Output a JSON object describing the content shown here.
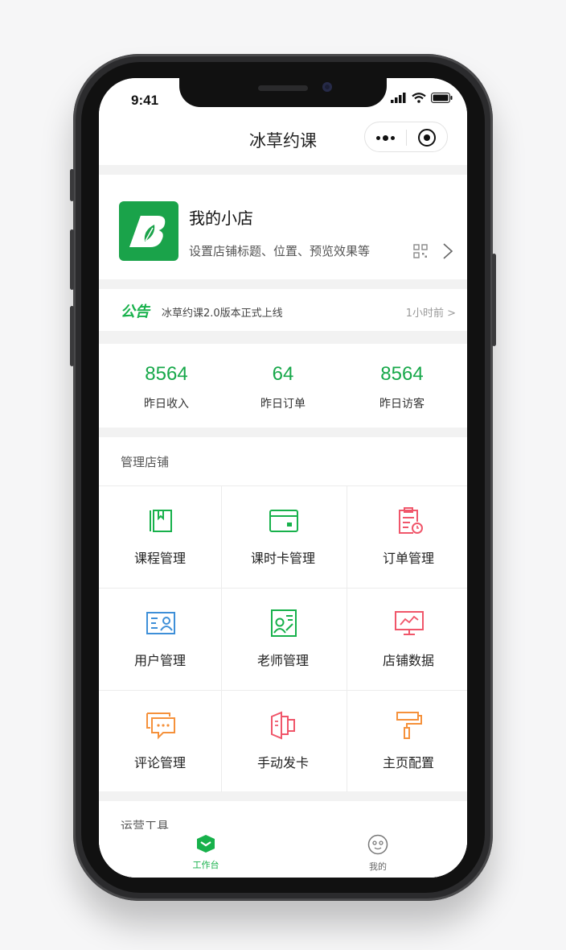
{
  "status_bar": {
    "time": "9:41"
  },
  "nav": {
    "title": "冰草约课"
  },
  "shop": {
    "name": "我的小店",
    "desc": "设置店铺标题、位置、预览效果等"
  },
  "notice": {
    "tag": "公告",
    "text": "冰草约课2.0版本正式上线",
    "time": "1小时前 >"
  },
  "stats": [
    {
      "value": "8564",
      "label": "昨日收入"
    },
    {
      "value": "64",
      "label": "昨日订单"
    },
    {
      "value": "8564",
      "label": "昨日访客"
    }
  ],
  "manage": {
    "title": "管理店铺",
    "items": [
      {
        "label": "课程管理",
        "icon": "course-icon",
        "color": "#17b14b"
      },
      {
        "label": "课时卡管理",
        "icon": "card-icon",
        "color": "#17b14b"
      },
      {
        "label": "订单管理",
        "icon": "order-icon",
        "color": "#f0566a"
      },
      {
        "label": "用户管理",
        "icon": "user-card-icon",
        "color": "#3e8fd8"
      },
      {
        "label": "老师管理",
        "icon": "teacher-icon",
        "color": "#17b14b"
      },
      {
        "label": "店铺数据",
        "icon": "data-screen-icon",
        "color": "#f0566a"
      },
      {
        "label": "评论管理",
        "icon": "comment-icon",
        "color": "#f5913b"
      },
      {
        "label": "手动发卡",
        "icon": "issue-card-icon",
        "color": "#f0566a"
      },
      {
        "label": "主页配置",
        "icon": "paint-roller-icon",
        "color": "#f5913b"
      }
    ]
  },
  "ops": {
    "title": "运营工具"
  },
  "tabbar": {
    "items": [
      {
        "label": "工作台",
        "icon": "workbench-icon",
        "active": true
      },
      {
        "label": "我的",
        "icon": "smile-icon",
        "active": false
      }
    ]
  },
  "colors": {
    "accent": "#17b14b",
    "page_bg": "#f2f2f2"
  }
}
